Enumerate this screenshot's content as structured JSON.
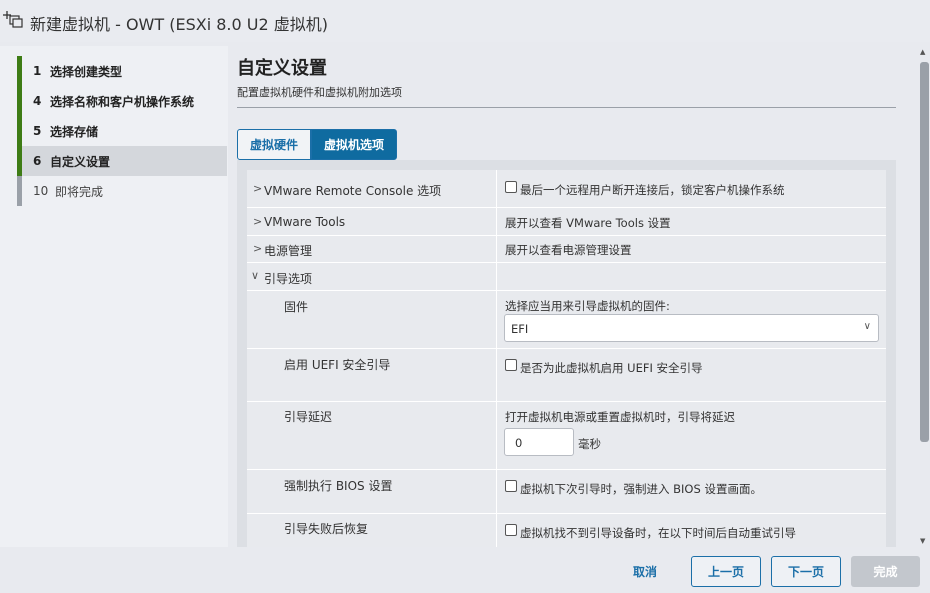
{
  "window": {
    "title": "新建虚拟机 - OWT (ESXi 8.0 U2 虚拟机)",
    "icon": "new-vm-icon"
  },
  "steps": [
    {
      "num": "1",
      "label": "选择创建类型",
      "state": "done"
    },
    {
      "num": "4",
      "label": "选择名称和客户机操作系统",
      "state": "done"
    },
    {
      "num": "5",
      "label": "选择存储",
      "state": "done"
    },
    {
      "num": "6",
      "label": "自定义设置",
      "state": "active"
    },
    {
      "num": "10",
      "label": "即将完成",
      "state": "future"
    }
  ],
  "main": {
    "title": "自定义设置",
    "subtitle": "配置虚拟机硬件和虚拟机附加选项"
  },
  "tabs": [
    {
      "label": "虚拟硬件",
      "active": false
    },
    {
      "label": "虚拟机选项",
      "active": true
    }
  ],
  "rows": {
    "vmrc": {
      "label": "VMware Remote Console 选项",
      "value": "最后一个远程用户断开连接后，锁定客户机操作系统",
      "checked": false
    },
    "tools": {
      "label": "VMware Tools",
      "value": "展开以查看 VMware Tools 设置"
    },
    "power": {
      "label": "电源管理",
      "value": "展开以查看电源管理设置"
    },
    "boot": {
      "label": "引导选项"
    },
    "firmware": {
      "label": "固件",
      "hint": "选择应当用来引导虚拟机的固件:",
      "selected": "EFI"
    },
    "secureboot": {
      "label": "启用 UEFI 安全引导",
      "value": "是否为此虚拟机启用 UEFI 安全引导",
      "checked": false
    },
    "bootdelay": {
      "label": "引导延迟",
      "hint": "打开虚拟机电源或重置虚拟机时，引导将延迟",
      "input_value": "0",
      "unit": "毫秒"
    },
    "forcebios": {
      "label": "强制执行 BIOS 设置",
      "value": "虚拟机下次引导时，强制进入 BIOS 设置画面。",
      "checked": false
    },
    "failrecovery": {
      "label": "引导失败后恢复",
      "value": "虚拟机找不到引导设备时，在以下时间后自动重试引导",
      "checked": false
    }
  },
  "footer": {
    "cancel": "取消",
    "back": "上一页",
    "next": "下一页",
    "finish": "完成"
  },
  "colors": {
    "accent": "#1b6fa8",
    "step_done": "#3e7c15",
    "tab_active": "#0f6ba0",
    "disabled": "#c3c7cd"
  }
}
